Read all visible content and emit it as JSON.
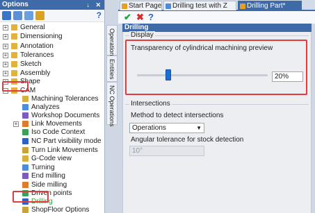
{
  "options_panel": {
    "title": "Options",
    "tree": [
      {
        "id": "general",
        "label": "General"
      },
      {
        "id": "dimensioning",
        "label": "Dimensioning"
      },
      {
        "id": "annotation",
        "label": "Annotation"
      },
      {
        "id": "tolerances",
        "label": "Tolerances"
      },
      {
        "id": "sketch",
        "label": "Sketch"
      },
      {
        "id": "assembly",
        "label": "Assembly"
      },
      {
        "id": "shape",
        "label": "Shape"
      },
      {
        "id": "cam",
        "label": "CAM"
      },
      {
        "id": "machining-tolerances",
        "label": "Machining Tolerances"
      },
      {
        "id": "analyzes",
        "label": "Analyzes"
      },
      {
        "id": "workshop-documents",
        "label": "Workshop Documents"
      },
      {
        "id": "link-movements",
        "label": "Link Movements"
      },
      {
        "id": "iso-code-context",
        "label": "Iso Code Context"
      },
      {
        "id": "nc-part-visibility-mode",
        "label": "NC Part visibility mode"
      },
      {
        "id": "turn-link-movements",
        "label": "Turn Link Movements"
      },
      {
        "id": "g-code-view",
        "label": "G-Code view"
      },
      {
        "id": "turning",
        "label": "Turning"
      },
      {
        "id": "end-milling",
        "label": "End milling"
      },
      {
        "id": "side-milling",
        "label": "Side milling"
      },
      {
        "id": "driven-points",
        "label": "Driven points"
      },
      {
        "id": "drilling",
        "label": "Drilling"
      },
      {
        "id": "shopfloor-options",
        "label": "ShopFloor Options"
      }
    ]
  },
  "side_tabs": [
    "Operations",
    "Entities",
    "NC Operations"
  ],
  "doc_tabs": [
    {
      "label": "Start Page",
      "active": false
    },
    {
      "label": "Drilling test with Z",
      "active": false
    },
    {
      "label": "Drilling Part*",
      "active": true
    }
  ],
  "panel": {
    "title": "Drilling",
    "display_group": "Display",
    "transparency_label": "Transparency of cylindrical machining preview",
    "transparency_value": "20%",
    "transparency_level": 0.2,
    "intersections_group": "Intersections",
    "method_label": "Method to detect intersections",
    "method_value": "Operations",
    "angular_label": "Angular tolerance for stock detection",
    "angular_value": "10°"
  },
  "colors": {
    "title_bar": "#3f6aa8",
    "highlight_box": "#e23b3b",
    "slider_thumb": "#1d6fd6"
  }
}
